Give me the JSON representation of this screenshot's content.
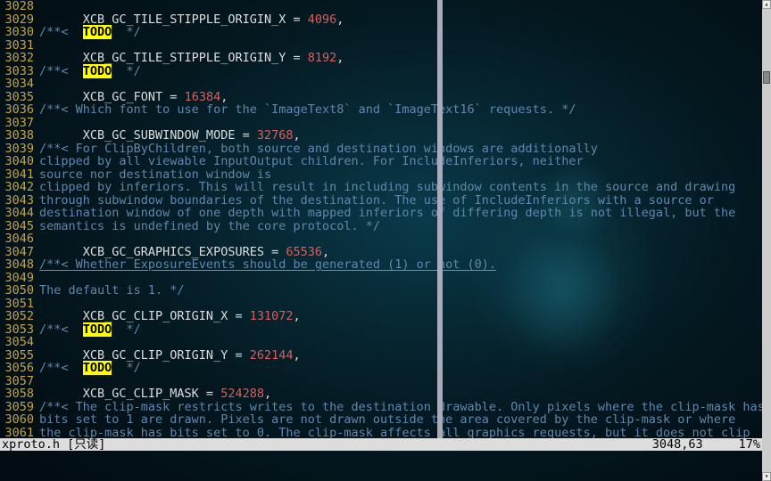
{
  "file_name": "xproto.h",
  "readonly_label": " [只读] ",
  "cursor_pos": "3048,63",
  "scroll_pct": "17%",
  "first_line_no": 3028,
  "todo_text": "TODO",
  "lines": [
    {
      "raw": "",
      "parts": [
        [
          "",
          ""
        ]
      ]
    },
    {
      "raw": "      XCB_GC_TILE_STIPPLE_ORIGIN_X = 4096,",
      "parts": [
        [
          "      XCB_GC_TILE_STIPPLE_ORIGIN_X = ",
          "kw"
        ],
        [
          "4096",
          "num"
        ],
        [
          ",",
          "kw"
        ]
      ]
    },
    {
      "raw": "/**<  TODO  */",
      "parts": [
        [
          "/**<  ",
          "cmt"
        ],
        [
          "TODO",
          "todo"
        ],
        [
          "  */",
          "cmt"
        ]
      ]
    },
    {
      "raw": "",
      "parts": [
        [
          "",
          ""
        ]
      ]
    },
    {
      "raw": "      XCB_GC_TILE_STIPPLE_ORIGIN_Y = 8192,",
      "parts": [
        [
          "      XCB_GC_TILE_STIPPLE_ORIGIN_Y = ",
          "kw"
        ],
        [
          "8192",
          "num"
        ],
        [
          ",",
          "kw"
        ]
      ]
    },
    {
      "raw": "/**<  TODO  */",
      "parts": [
        [
          "/**<  ",
          "cmt"
        ],
        [
          "TODO",
          "todo"
        ],
        [
          "  */",
          "cmt"
        ]
      ]
    },
    {
      "raw": "",
      "parts": [
        [
          "",
          ""
        ]
      ]
    },
    {
      "raw": "      XCB_GC_FONT = 16384,",
      "parts": [
        [
          "      XCB_GC_FONT = ",
          "kw"
        ],
        [
          "16384",
          "num"
        ],
        [
          ",",
          "kw"
        ]
      ]
    },
    {
      "raw": "/**< Which font to use for the `ImageText8` and `ImageText16` requests. */",
      "parts": [
        [
          "/**< Which font to use for the `ImageText8` and `ImageText16` requests. */",
          "cmt"
        ]
      ]
    },
    {
      "raw": "",
      "parts": [
        [
          "",
          ""
        ]
      ]
    },
    {
      "raw": "      XCB_GC_SUBWINDOW_MODE = 32768,",
      "parts": [
        [
          "      XCB_GC_SUBWINDOW_MODE = ",
          "kw"
        ],
        [
          "32768",
          "num"
        ],
        [
          ",",
          "kw"
        ]
      ]
    },
    {
      "raw": "/**< For ClipByChildren, both source and destination windows are additionally",
      "parts": [
        [
          "/**< For ClipByChildren, both source and destination windows are additionally",
          "cmt"
        ]
      ]
    },
    {
      "raw": "clipped by all viewable InputOutput children. For IncludeInferiors, neither",
      "parts": [
        [
          "clipped by all viewable InputOutput children. For IncludeInferiors, neither",
          "cmt"
        ]
      ]
    },
    {
      "raw": "source nor destination window is",
      "parts": [
        [
          "source nor destination window is",
          "cmt"
        ]
      ]
    },
    {
      "raw": "clipped by inferiors. This will result in including subwindow contents in the source and drawing",
      "parts": [
        [
          "clipped by inferiors. This will result in including subwindow contents in the source and drawing",
          "cmt"
        ]
      ]
    },
    {
      "raw": "through subwindow boundaries of the destination. The use of IncludeInferiors with a source or",
      "parts": [
        [
          "through subwindow boundaries of the destination. The use of IncludeInferiors with a source or",
          "cmt"
        ]
      ]
    },
    {
      "raw": "destination window of one depth with mapped inferiors of differing depth is not illegal, but the",
      "parts": [
        [
          "destination window of one depth with mapped inferiors of differing depth is not illegal, but the",
          "cmt"
        ]
      ]
    },
    {
      "raw": "semantics is undefined by the core protocol. */",
      "parts": [
        [
          "semantics is undefined by the core protocol. */",
          "cmt"
        ]
      ]
    },
    {
      "raw": "",
      "parts": [
        [
          "",
          ""
        ]
      ]
    },
    {
      "raw": "      XCB_GC_GRAPHICS_EXPOSURES = 65536,",
      "parts": [
        [
          "      XCB_GC_GRAPHICS_EXPOSURES = ",
          "kw"
        ],
        [
          "65536",
          "num"
        ],
        [
          ",",
          "kw"
        ]
      ]
    },
    {
      "raw": "/**< Whether ExposureEvents should be generated (1) or not (0).",
      "parts": [
        [
          "/**< Whether ExposureEvents should be generated (1) or not (0).",
          "cmt"
        ]
      ],
      "cursor": true
    },
    {
      "raw": "",
      "parts": [
        [
          "",
          ""
        ]
      ]
    },
    {
      "raw": "The default is 1. */",
      "parts": [
        [
          "The default is 1. */",
          "cmt"
        ]
      ]
    },
    {
      "raw": "",
      "parts": [
        [
          "",
          ""
        ]
      ]
    },
    {
      "raw": "      XCB_GC_CLIP_ORIGIN_X = 131072,",
      "parts": [
        [
          "      XCB_GC_CLIP_ORIGIN_X = ",
          "kw"
        ],
        [
          "131072",
          "num"
        ],
        [
          ",",
          "kw"
        ]
      ]
    },
    {
      "raw": "/**<  TODO  */",
      "parts": [
        [
          "/**<  ",
          "cmt"
        ],
        [
          "TODO",
          "todo"
        ],
        [
          "  */",
          "cmt"
        ]
      ]
    },
    {
      "raw": "",
      "parts": [
        [
          "",
          ""
        ]
      ]
    },
    {
      "raw": "      XCB_GC_CLIP_ORIGIN_Y = 262144,",
      "parts": [
        [
          "      XCB_GC_CLIP_ORIGIN_Y = ",
          "kw"
        ],
        [
          "262144",
          "num"
        ],
        [
          ",",
          "kw"
        ]
      ]
    },
    {
      "raw": "/**<  TODO  */",
      "parts": [
        [
          "/**<  ",
          "cmt"
        ],
        [
          "TODO",
          "todo"
        ],
        [
          "  */",
          "cmt"
        ]
      ]
    },
    {
      "raw": "",
      "parts": [
        [
          "",
          ""
        ]
      ]
    },
    {
      "raw": "      XCB_GC_CLIP_MASK = 524288,",
      "parts": [
        [
          "      XCB_GC_CLIP_MASK = ",
          "kw"
        ],
        [
          "524288",
          "num"
        ],
        [
          ",",
          "kw"
        ]
      ]
    },
    {
      "raw": "/**< The clip-mask restricts writes to the destination drawable. Only pixels where the clip-mask has",
      "parts": [
        [
          "/**< The clip-mask restricts writes to the destination drawable. Only pixels where the clip-mask has",
          "cmt"
        ]
      ]
    },
    {
      "raw": "bits set to 1 are drawn. Pixels are not drawn outside the area covered by the clip-mask or where",
      "parts": [
        [
          "bits set to 1 are drawn. Pixels are not drawn outside the area covered by the clip-mask or where",
          "cmt"
        ]
      ]
    },
    {
      "raw": "the clip-mask has bits set to 0. The clip-mask affects all graphics requests, but it does not clip",
      "parts": [
        [
          "the clip-mask has bits set to 0. The clip-mask affects all graphics requests, but it does not clip",
          "cmt"
        ]
      ]
    }
  ]
}
